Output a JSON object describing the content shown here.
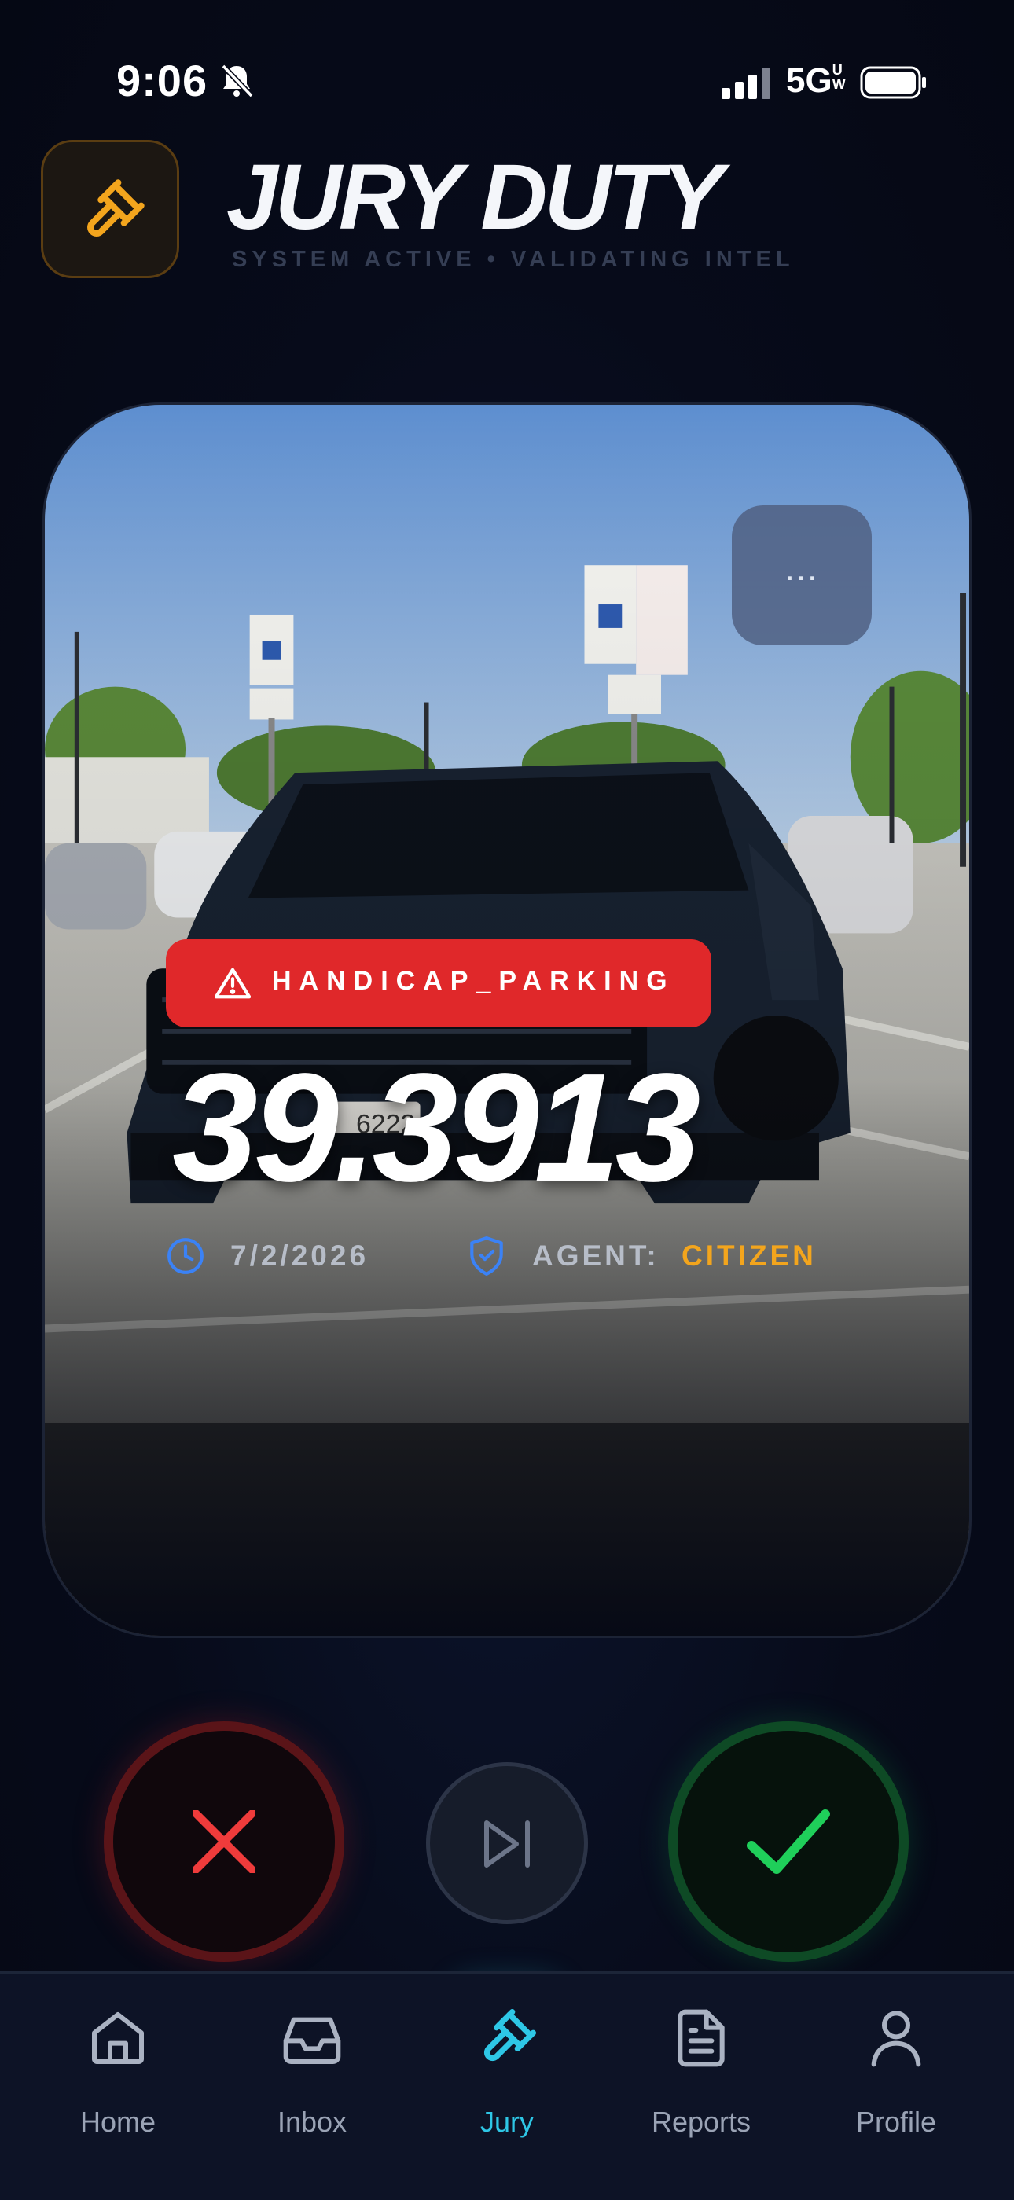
{
  "status_bar": {
    "time": "9:06",
    "network": "5G",
    "network_suffix": "UW"
  },
  "header": {
    "title": "JURY DUTY",
    "subtitle": "SYSTEM ACTIVE • VALIDATING INTEL"
  },
  "report_card": {
    "more_label": "...",
    "violation": "HANDICAP_PARKING",
    "score": "39.3913",
    "date": "7/2/2026",
    "agent_label": "AGENT:",
    "agent_value": "CITIZEN",
    "photo_plate": "6222"
  },
  "actions": {
    "reject": "reject",
    "skip": "skip",
    "approve": "approve"
  },
  "tabbar": {
    "items": [
      {
        "label": "Home",
        "icon": "home-icon"
      },
      {
        "label": "Inbox",
        "icon": "inbox-icon"
      },
      {
        "label": "Jury",
        "icon": "gavel-icon",
        "active": true
      },
      {
        "label": "Reports",
        "icon": "document-icon"
      },
      {
        "label": "Profile",
        "icon": "person-icon"
      }
    ]
  },
  "colors": {
    "accent_orange": "#f3a51d",
    "alert_red": "#e0282a",
    "approve_green": "#1fcf5a",
    "active_cyan": "#2ec7e6",
    "background": "#060a18"
  }
}
